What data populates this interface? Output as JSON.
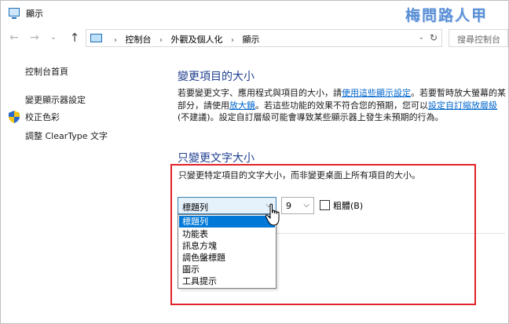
{
  "window": {
    "title": "顯示",
    "watermark": "梅問路人甲"
  },
  "nav": {
    "back": "←",
    "forward": "→",
    "recent": "⌄",
    "up": "↑",
    "breadcrumb": [
      "控制台",
      "外觀及個人化",
      "顯示"
    ],
    "crumb_sep": "›",
    "address_dropdown": "⌄",
    "refresh": "↻",
    "search_placeholder": "搜尋控制台"
  },
  "sidebar": {
    "items": [
      {
        "label": "控制台首頁"
      },
      {
        "label": "變更顯示器設定"
      },
      {
        "label": "校正色彩",
        "icon": "shield-icon"
      },
      {
        "label": "調整 ClearType 文字"
      }
    ]
  },
  "main": {
    "heading": "變更項目的大小",
    "desc_part1": "若要變更文字、應用程式與項目的大小，請",
    "desc_link1": "使用這些顯示設定",
    "desc_part2": "。若要暫時放大螢幕的某部分，請使用",
    "desc_link2": "放大鏡",
    "desc_part3": "。若這些功能的效果不符合您的預期，您可以",
    "desc_link3": "設定自訂縮放層級",
    "desc_part4": " (不建議)。設定自訂層級可能會導致某些顯示器上發生未預期的行為。",
    "text_only_heading": "只變更文字大小",
    "text_only_desc": "只變更特定項目的文字大小，而非變更桌面上所有項目的大小。",
    "item_select": {
      "selected": "標題列",
      "arrow": "⌵",
      "options": [
        "標題列",
        "功能表",
        "訊息方塊",
        "調色盤標題",
        "圖示",
        "工具提示"
      ]
    },
    "size_select": {
      "value": "9",
      "arrow": "⌵"
    },
    "bold_checkbox": {
      "label": "粗體(B)",
      "checked": false
    }
  },
  "colors": {
    "accent": "#0078d7",
    "heading": "#1e3e8e",
    "link": "#0066cc",
    "highlight_box": "#e0222a"
  }
}
